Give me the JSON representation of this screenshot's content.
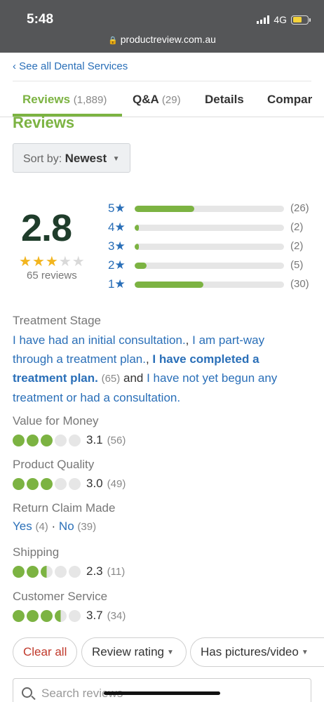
{
  "status_bar": {
    "time": "5:48",
    "network": "4G",
    "url": "productreview.com.au"
  },
  "nav": {
    "back_link": "‹ See all Dental Services"
  },
  "tabs": [
    {
      "label": "Reviews",
      "count": "(1,889)"
    },
    {
      "label": "Q&A",
      "count": "(29)"
    },
    {
      "label": "Details",
      "count": ""
    },
    {
      "label": "Compar",
      "count": ""
    }
  ],
  "section_title": "Reviews",
  "sort": {
    "prefix": "Sort by:",
    "value": "Newest"
  },
  "summary": {
    "rating": "2.8",
    "stars_filled": 3,
    "stars_total": 5,
    "reviews_label": "65 reviews"
  },
  "distribution": [
    {
      "label": "5★",
      "count": "(26)",
      "fraction": 0.4
    },
    {
      "label": "4★",
      "count": "(2)",
      "fraction": 0.03
    },
    {
      "label": "3★",
      "count": "(2)",
      "fraction": 0.03
    },
    {
      "label": "2★",
      "count": "(5)",
      "fraction": 0.08
    },
    {
      "label": "1★",
      "count": "(30)",
      "fraction": 0.46
    }
  ],
  "treatment_stage": {
    "label": "Treatment Stage",
    "opt1": "I have had an initial consultation.",
    "sep1": ", ",
    "opt2": "I am part-way through a treatment plan.",
    "sep2": ", ",
    "opt3": "I have completed a treatment plan.",
    "opt3_count": "(65)",
    "and": " and ",
    "opt4": "I have not yet begun any treatment or had a consultation."
  },
  "attributes": [
    {
      "label": "Value for Money",
      "score": "3.1",
      "count": "(56)",
      "dots": [
        "on",
        "on",
        "on",
        "off",
        "off"
      ]
    },
    {
      "label": "Product Quality",
      "score": "3.0",
      "count": "(49)",
      "dots": [
        "on",
        "on",
        "on",
        "off",
        "off"
      ]
    },
    {
      "label": "Shipping",
      "score": "2.3",
      "count": "(11)",
      "dots": [
        "on",
        "on",
        "half",
        "off",
        "off"
      ]
    },
    {
      "label": "Customer Service",
      "score": "3.7",
      "count": "(34)",
      "dots": [
        "on",
        "on",
        "on",
        "half",
        "off"
      ]
    }
  ],
  "return_claim": {
    "label": "Return Claim Made",
    "yes": "Yes",
    "yes_count": "(4)",
    "sep": " · ",
    "no": "No",
    "no_count": "(39)"
  },
  "filters": {
    "clear": "Clear all",
    "rating": "Review rating",
    "pictures": "Has pictures/video"
  },
  "search": {
    "placeholder": "Search reviews"
  },
  "colors": {
    "accent_green": "#7cb342",
    "link_blue": "#2a6fb8",
    "star_gold": "#f2b51f",
    "rating_dark": "#1f3d2b"
  }
}
